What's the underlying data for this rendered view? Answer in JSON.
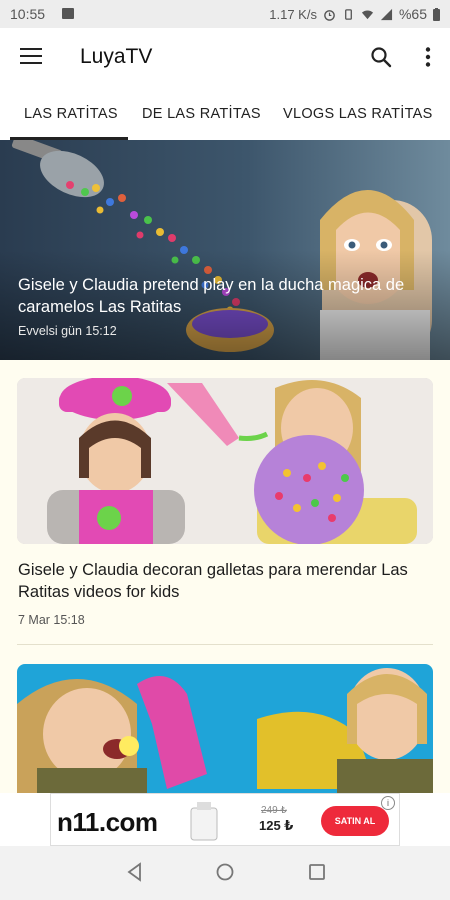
{
  "status_bar": {
    "time": "10:55",
    "speed": "1.17 K/s",
    "battery": "%65"
  },
  "app_bar": {
    "title": "LuyaTV",
    "icons": [
      "menu-icon",
      "search-icon",
      "more-vert-icon"
    ]
  },
  "tabs": [
    {
      "label": "LAS RATİTAS",
      "selected": true
    },
    {
      "label": "DE LAS RATİTAS",
      "selected": false
    },
    {
      "label": "VLOGS LAS RATİTAS",
      "selected": false
    }
  ],
  "featured": {
    "title": "Gisele y Claudia pretend play en la ducha magica de caramelos Las Ratitas",
    "time": "Evvelsi gün 15:12"
  },
  "videos": [
    {
      "title": "Gisele y Claudia decoran galletas para merendar Las Ratitas videos for kids",
      "time": "7 Mar 15:18"
    }
  ],
  "ad": {
    "logo": "n11.com",
    "old_price": "249 ₺",
    "price": "125 ₺",
    "button": "SATIN AL",
    "info": "i"
  },
  "colors": {
    "tab_indicator": "#222222",
    "ad_button": "#ee2a3b",
    "feed_background": "#fffdf0"
  }
}
